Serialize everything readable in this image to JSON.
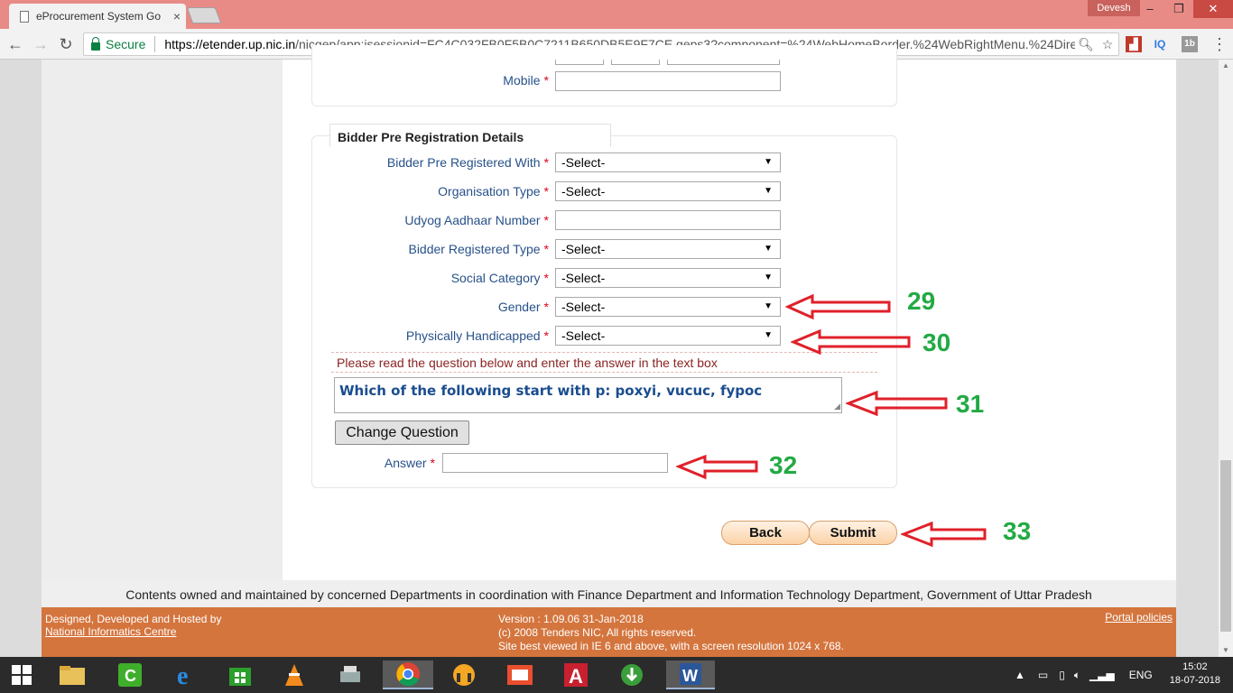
{
  "browser": {
    "tab_title": "eProcurement System Go",
    "tab_close": "×",
    "profile_name": "Devesh",
    "win_min": "–",
    "win_max": "❐",
    "win_close": "✕",
    "secure_label": "Secure",
    "url_host": "https://etender.up.nic.in",
    "url_rest": "/nicgep/app;jsessionid=FC4C032FB0F5B0C7211B650DB5E9F7CE.geps3?component=%24WebHomeBorder.%24WebRightMenu.%24Direc...",
    "ext_iq": "IQ",
    "ext_1b": "1b"
  },
  "form": {
    "mobile_label": "Mobile",
    "section_title": "Bidder Pre Registration Details",
    "required_mark": "*",
    "fields": {
      "pre_registered_with": {
        "label": "Bidder Pre Registered With",
        "value": "-Select-"
      },
      "organisation_type": {
        "label": "Organisation Type",
        "value": "-Select-"
      },
      "udyog_aadhaar": {
        "label": "Udyog Aadhaar Number",
        "value": ""
      },
      "registered_type": {
        "label": "Bidder Registered Type",
        "value": "-Select-"
      },
      "social_category": {
        "label": "Social Category",
        "value": "-Select-"
      },
      "gender": {
        "label": "Gender",
        "value": "-Select-"
      },
      "physically_handicapped": {
        "label": "Physically Handicapped",
        "value": "-Select-"
      }
    },
    "question_note": "Please read the question below and enter the answer in the text box",
    "question_text": "Which of the following start with p: poxyi, vucuc, fypoc",
    "change_question_label": "Change Question",
    "answer_label": "Answer",
    "back_label": "Back",
    "submit_label": "Submit"
  },
  "annotations": {
    "n29": "29",
    "n30": "30",
    "n31": "31",
    "n32": "32",
    "n33": "33",
    "arrow_color": "#e0202a",
    "number_color": "#22aa44"
  },
  "footer": {
    "ownership": "Contents owned and maintained by concerned Departments in coordination with Finance Department and Information Technology Department, Government of Uttar Pradesh",
    "designed_by": "Designed, Developed and Hosted by",
    "nic_link": "National Informatics Centre",
    "version": "Version : 1.09.06 31-Jan-2018",
    "copyright": "(c) 2008 Tenders NIC, All rights reserved.",
    "best_viewed": "Site best viewed in IE 6 and above, with a screen resolution 1024 x 768.",
    "portal_policies": "Portal policies"
  },
  "taskbar": {
    "language": "ENG",
    "time": "15:02",
    "date": "18-07-2018"
  },
  "colors": {
    "footer_orange": "#d4753e",
    "label_blue": "#27518a",
    "titlebar": "#e88b86"
  }
}
